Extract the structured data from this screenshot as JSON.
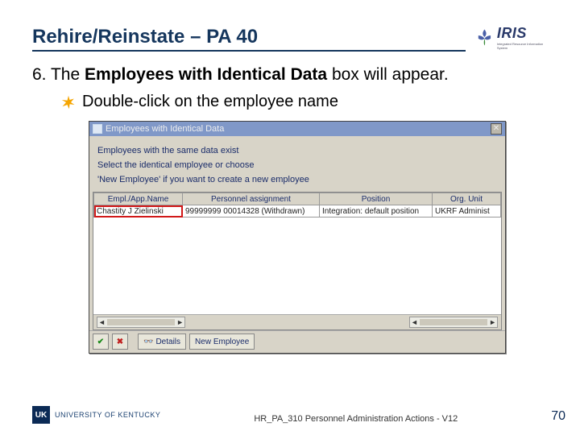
{
  "slide": {
    "title": "Rehire/Reinstate – PA 40",
    "logo": {
      "brand": "IRIS",
      "tagline": "Integrated Resource Information System"
    }
  },
  "step": {
    "number": "6.",
    "text_prefix": "The ",
    "bold_phrase": "Employees with Identical Data",
    "text_suffix": " box will appear.",
    "bullet": "Double-click on the employee name"
  },
  "dialog": {
    "title": "Employees with Identical Data",
    "close": "✕",
    "msg1": "Employees with the same data exist",
    "msg2": "Select the identical employee or choose",
    "msg3": "'New Employee' if you want to create a new employee",
    "columns": [
      "Empl./App.Name",
      "Personnel assignment",
      "Position",
      "Org. Unit"
    ],
    "row": {
      "name": "Chastity J Zielinski",
      "assignment": "99999999 00014328 (Withdrawn)",
      "position": "Integration: default position",
      "org": "UKRF Administ"
    },
    "scroll_left_a": "◄",
    "scroll_left_b": "◄",
    "scroll_right_a": "►",
    "scroll_right_b": "►",
    "toolbar": {
      "ok": "✔",
      "cancel": "✖",
      "details_icon": "👓",
      "details": "Details",
      "new": "New Employee"
    }
  },
  "footer": {
    "uk_abbrev": "UK",
    "uk_name": "UNIVERSITY OF KENTUCKY",
    "doc": "HR_PA_310 Personnel Administration Actions - V12",
    "page": "70"
  }
}
